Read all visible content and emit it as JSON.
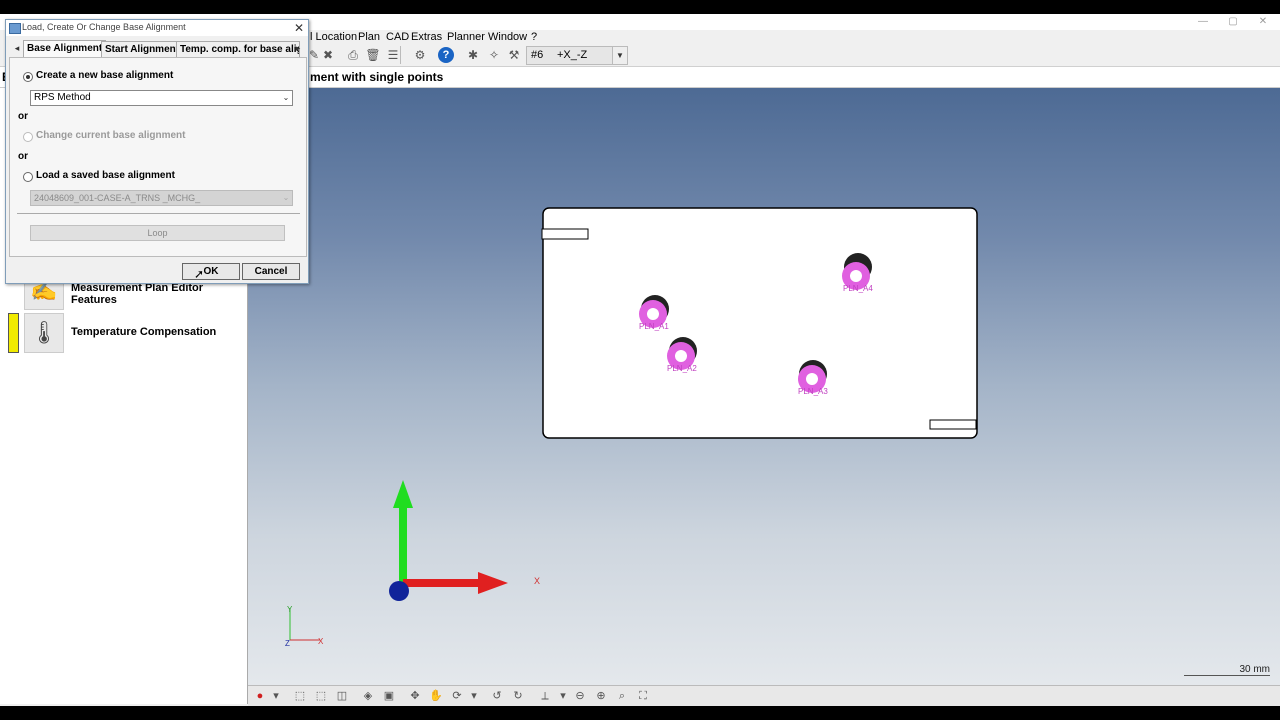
{
  "window": {
    "controls": [
      "—",
      "▢",
      "✕"
    ]
  },
  "menubar": {
    "items": [
      "l Location",
      "Plan",
      "CAD",
      "Extras",
      "Planner",
      "Window",
      "?"
    ]
  },
  "toolbar": {
    "view_number": "#6",
    "view_direction": "+X_-Z",
    "help_label": "?"
  },
  "info": {
    "text": "ment with single points",
    "left_stub": "E"
  },
  "features": [
    {
      "label": "Measurement Plan Editor Features",
      "icon": "measure-probe-icon"
    },
    {
      "label": "Temperature Compensation",
      "icon": "thermometer-gear-icon",
      "bar_color": "#f0ea00"
    }
  ],
  "dialog": {
    "title": "Load, Create Or Change Base Alignment",
    "tabs": [
      "Base Alignment",
      "Start Alignment",
      "Temp. comp. for base alig"
    ],
    "create_label": "Create a new base alignment",
    "method_value": "RPS Method",
    "or1": "or",
    "change_label": "Change current base alignment",
    "or2": "or",
    "load_label": "Load a saved base alignment",
    "saved_value": "24048609_001-CASE-A_TRNS _MCHG_",
    "loop_label": "Loop",
    "ok_label": "OK",
    "cancel_label": "Cancel"
  },
  "viewport": {
    "points": [
      "PLN_A1",
      "PLN_A2",
      "PLN_A3",
      "PLN_A4"
    ],
    "point_color": "#e060e0",
    "axis_x_label": "X",
    "mini_x": "X",
    "mini_y": "Y",
    "mini_z": "Z",
    "scale_label": "30 mm"
  }
}
